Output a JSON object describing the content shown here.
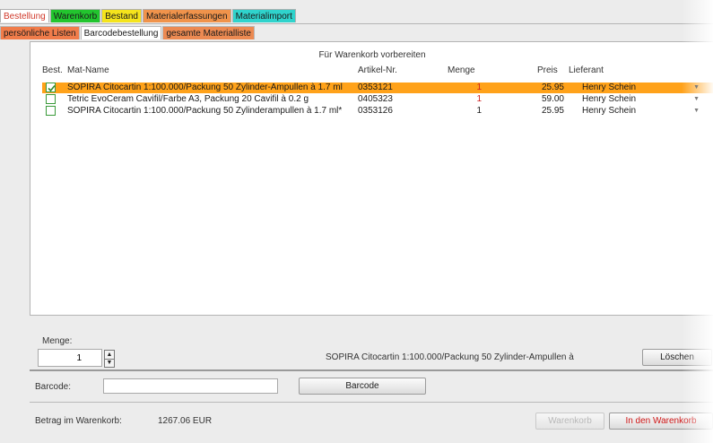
{
  "colors": {
    "selected_row": "#ffa21a",
    "active_tab_text": "#d0392b",
    "quantity_red": "#d02020"
  },
  "top_tabs": [
    {
      "label": "Bestellung",
      "bg": "#ffffff",
      "active": true
    },
    {
      "label": "Warenkorb",
      "bg": "#22c52e"
    },
    {
      "label": "Bestand",
      "bg": "#f5e41c"
    },
    {
      "label": "Materialerfassungen",
      "bg": "#f0934b"
    },
    {
      "label": "Materialimport",
      "bg": "#2fd3cc"
    }
  ],
  "sub_tabs": [
    {
      "label": "persönliche Listen",
      "bg": "#f07c4a"
    },
    {
      "label": "Barcodebestellung",
      "bg": "#ffffff",
      "active": true
    },
    {
      "label": "gesamte Materialliste",
      "bg": "#ec8a52"
    }
  ],
  "panel": {
    "title": "Für Warenkorb vorbereiten",
    "headers": {
      "best": "Best.",
      "name": "Mat-Name",
      "artnr": "Artikel-Nr.",
      "menge": "Menge",
      "preis": "Preis",
      "lieferant": "Lieferant"
    },
    "rows": [
      {
        "checked": true,
        "name": "SOPIRA Citocartin 1:100.000/Packung 50 Zylinder-Ampullen à 1.7 ml",
        "artnr": "0353121",
        "menge": "1",
        "preis": "25.95",
        "lieferant": "Henry Schein",
        "selected": true
      },
      {
        "checked": false,
        "name": "Tetric EvoCeram Cavifil/Farbe A3, Packung 20 Cavifil à 0.2 g",
        "artnr": "0405323",
        "menge": "1",
        "preis": "59.00",
        "lieferant": "Henry Schein"
      },
      {
        "checked": false,
        "name": "SOPIRA Citocartin 1:100.000/Packung 50 Zylinderampullen à 1.7 ml*",
        "artnr": "0353126",
        "menge": "1",
        "preis": "25.95",
        "lieferant": "Henry Schein"
      }
    ]
  },
  "menge": {
    "label": "Menge:",
    "value": "1",
    "selected_item_text": "SOPIRA Citocartin 1:100.000/Packung 50 Zylinder-Ampullen à",
    "delete_label": "Löschen"
  },
  "barcode": {
    "label": "Barcode:",
    "value": "",
    "button_label": "Barcode"
  },
  "footer": {
    "amount_label": "Betrag im Warenkorb:",
    "amount_value": "1267.06 EUR",
    "warenkorb_button": "Warenkorb",
    "add_to_cart_button": "In den Warenkorb"
  }
}
